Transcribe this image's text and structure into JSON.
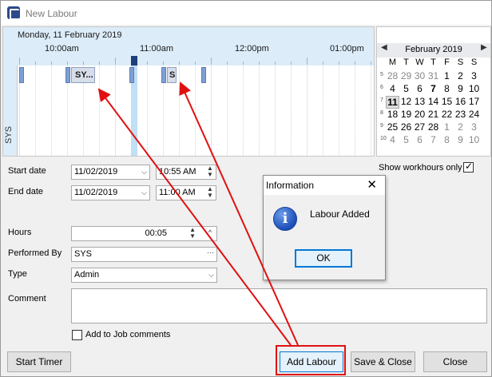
{
  "window": {
    "title": "New Labour"
  },
  "scheduler": {
    "date": "Monday, 11 February 2019",
    "times": [
      "10:00am",
      "11:00am",
      "12:00pm",
      "01:00pm"
    ],
    "resource": "SYS",
    "appointments": [
      {
        "label": "SY..."
      },
      {
        "label": "S"
      }
    ]
  },
  "calendar": {
    "month_label": "February 2019",
    "weekdays": [
      "M",
      "T",
      "W",
      "T",
      "F",
      "S",
      "S"
    ],
    "weeks": [
      {
        "wk": "5",
        "days": [
          "28",
          "29",
          "30",
          "31",
          "1",
          "2",
          "3"
        ]
      },
      {
        "wk": "6",
        "days": [
          "4",
          "5",
          "6",
          "7",
          "8",
          "9",
          "10"
        ]
      },
      {
        "wk": "7",
        "days": [
          "11",
          "12",
          "13",
          "14",
          "15",
          "16",
          "17"
        ]
      },
      {
        "wk": "8",
        "days": [
          "18",
          "19",
          "20",
          "21",
          "22",
          "23",
          "24"
        ]
      },
      {
        "wk": "9",
        "days": [
          "25",
          "26",
          "27",
          "28",
          "1",
          "2",
          "3"
        ]
      },
      {
        "wk": "10",
        "days": [
          "4",
          "5",
          "6",
          "7",
          "8",
          "9",
          "10"
        ]
      }
    ],
    "selected": "11"
  },
  "form": {
    "start_date_label": "Start date",
    "start_date": "11/02/2019",
    "start_time": "10:55 AM",
    "end_date_label": "End date",
    "end_date": "11/02/2019",
    "end_time": "11:00 AM",
    "show_workhours_label": "Show workhours only",
    "hours_label": "Hours",
    "hours_value": "00:05",
    "performed_by_label": "Performed By",
    "performed_by_value": "SYS",
    "type_label": "Type",
    "type_value": "Admin",
    "comment_label": "Comment",
    "add_to_job_label": "Add to Job comments",
    "ellipsis": "···"
  },
  "buttons": {
    "start_timer": "Start Timer",
    "add_labour": "Add Labour",
    "save_close": "Save & Close",
    "close": "Close"
  },
  "dialog": {
    "title": "Information",
    "message": "Labour Added",
    "ok": "OK",
    "close_glyph": "✕",
    "icon_glyph": "i"
  },
  "colors": {
    "accent": "#0078d7",
    "highlight": "#e01010",
    "schedule_header": "#dcecf8"
  }
}
